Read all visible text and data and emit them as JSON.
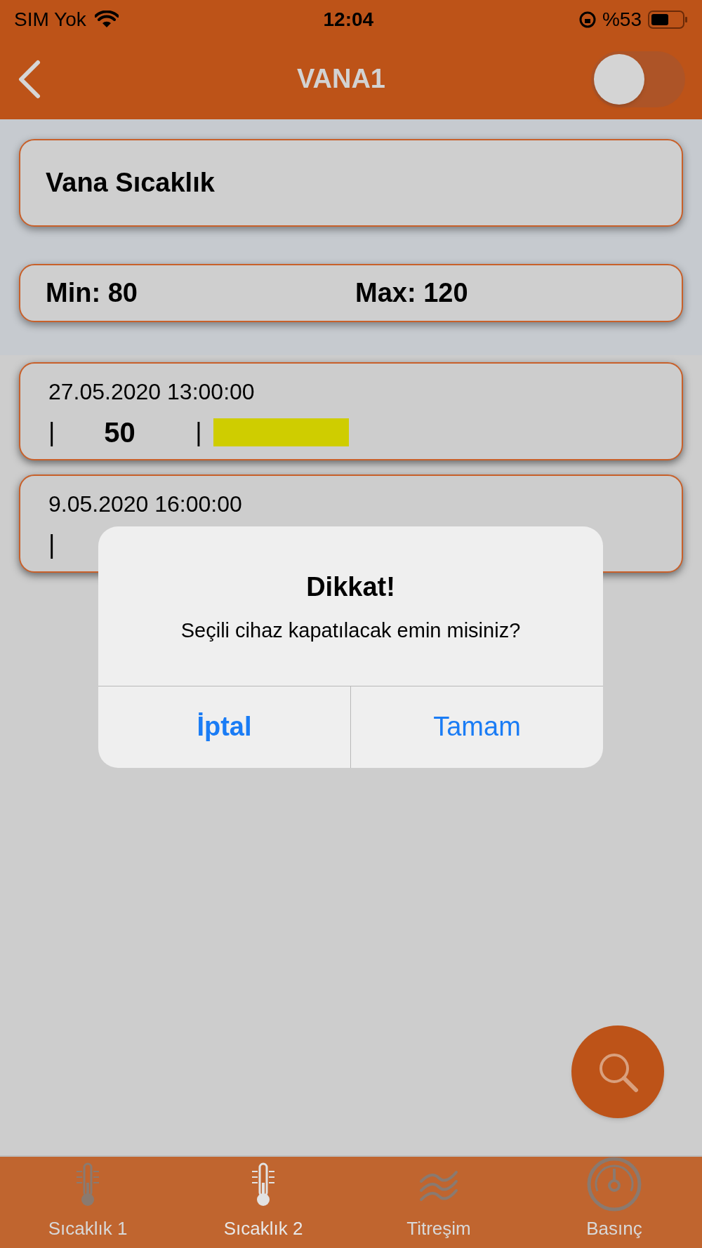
{
  "status_bar": {
    "carrier": "SIM Yok",
    "time": "12:04",
    "battery": "%53"
  },
  "nav": {
    "title": "VANA1",
    "toggle": {
      "on": false
    }
  },
  "header_card": {
    "title": "Vana Sıcaklık"
  },
  "range_card": {
    "min": "Min: 80",
    "max": "Max: 120"
  },
  "readings": [
    {
      "timestamp": "27.05.2020 13:00:00",
      "separators": [
        "|",
        "|"
      ],
      "value": "50",
      "bar": true
    },
    {
      "timestamp": "9.05.2020 16:00:00",
      "separators": [
        "|"
      ]
    }
  ],
  "alert": {
    "title": "Dikkat!",
    "message": "Seçili cihaz kapatılacak emin misiniz?",
    "buttons": [
      {
        "label": "İptal",
        "bold": true
      },
      {
        "label": "Tamam",
        "bold": false
      }
    ]
  },
  "tabs": [
    {
      "label": "Sıcaklık 1",
      "kind": "thermometer",
      "selected": false
    },
    {
      "label": "Sıcaklık 2",
      "kind": "thermometer",
      "selected": true
    },
    {
      "label": "Titreşim",
      "kind": "waves",
      "selected": false
    },
    {
      "label": "Basınç",
      "kind": "gauge",
      "selected": false
    }
  ]
}
